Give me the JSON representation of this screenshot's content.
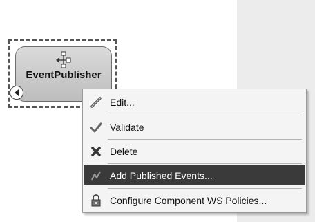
{
  "component": {
    "name": "EventPublisher",
    "icon": "event-publisher-icon",
    "expand_icon": "expand-arrow-icon"
  },
  "context_menu": {
    "items": [
      {
        "label": "Edit...",
        "icon": "pencil-icon"
      },
      {
        "label": "Validate",
        "icon": "checkmark-icon"
      },
      {
        "label": "Delete",
        "icon": "delete-x-icon"
      },
      {
        "label": "Add Published Events...",
        "icon": "lightning-icon",
        "highlighted": true
      },
      {
        "label": "Configure Component WS Policies...",
        "icon": "lock-icon"
      }
    ]
  },
  "colors": {
    "highlight": "#3a3a3a",
    "side_panel": "#ececec"
  }
}
